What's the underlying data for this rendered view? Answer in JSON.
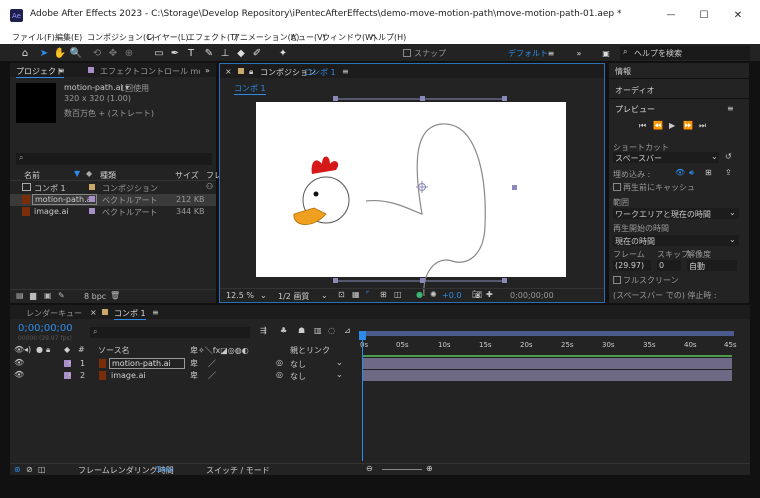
{
  "window": {
    "title": "Adobe After Effects 2023 - C:\\Storage\\Develop Repository\\iPentecAfterEffects\\demo-move-motion-path\\move-motion-path-01.aep *",
    "app_icon": "Ae",
    "min": "—",
    "max": "☐",
    "close": "✕"
  },
  "menu": [
    "ファイル(F)",
    "編集(E)",
    "コンポジション(C)",
    "レイヤー(L)",
    "エフェクト(T)",
    "アニメーション(A)",
    "ビュー(V)",
    "ウィンドウ(W)",
    "ヘルプ(H)"
  ],
  "toolbar": {
    "snap_label": "スナップ",
    "workspace": "デフォルト",
    "search_placeholder": "ヘルプを検索"
  },
  "project": {
    "tab_project": "プロジェクト",
    "tab_effects": "エフェクトコントロール motion-",
    "selected_name": "motion-path.ai ▾",
    "usage": "1回使用",
    "size": "320 x 320 (1.00)",
    "alpha": "数百万色 + (ストレート)",
    "search_placeholder": "",
    "col_name": "名前",
    "col_type": "種類",
    "col_size": "サイズ",
    "col_fr": "フレ",
    "items": [
      {
        "name": "コンポ 1",
        "type": "コンポジション",
        "size": ""
      },
      {
        "name": "motion-path.ai",
        "type": "ベクトルアート",
        "size": "212 KB"
      },
      {
        "name": "image.ai",
        "type": "ベクトルアート",
        "size": "344 KB"
      }
    ],
    "bpc": "8 bpc"
  },
  "comp": {
    "tab_label": "コンポジション",
    "tab_name": "コンポ 1",
    "inner_tab": "コンポ 1",
    "zoom": "12.5 %",
    "resolution": "1/2 画質",
    "exposure": "+0.0",
    "timecode": "0;00;00;00"
  },
  "right": {
    "info": "情報",
    "audio": "オーディオ",
    "preview": "プレビュー",
    "shortcut_label": "ショートカット",
    "shortcut_value": "スペースバー",
    "include_label": "埋め込み :",
    "cache_before": "再生前にキャッシュ",
    "range_label": "範囲",
    "range_value": "ワークエリアと現在の時間",
    "play_from_label": "再生開始の時間",
    "play_from_value": "現在の時間",
    "frame_label": "フレーム",
    "skip_label": "スキップ",
    "res_label": "解像度",
    "frame_value": "(29.97)",
    "skip_value": "0",
    "res_value": "自動",
    "fullscreen": "フルスクリーン",
    "stop_label": "(スペースバー での) 停止時 :"
  },
  "timeline": {
    "tab_render": "レンダーキュー",
    "tab_comp": "コンポ 1",
    "timecode": "0;00;00;00",
    "fps": "00000 (29.97 fps)",
    "col_source": "ソース名",
    "col_parent": "親とリンク",
    "layers": [
      {
        "num": "1",
        "name": "motion-path.ai",
        "parent": "なし"
      },
      {
        "num": "2",
        "name": "image.ai",
        "parent": "なし"
      }
    ],
    "ruler": [
      "0s",
      "05s",
      "10s",
      "15s",
      "20s",
      "25s",
      "30s",
      "35s",
      "40s",
      "45s"
    ],
    "footer_label": "フレームレンダリング時間",
    "footer_time": "3ms",
    "footer_mode": "スイッチ / モード"
  }
}
